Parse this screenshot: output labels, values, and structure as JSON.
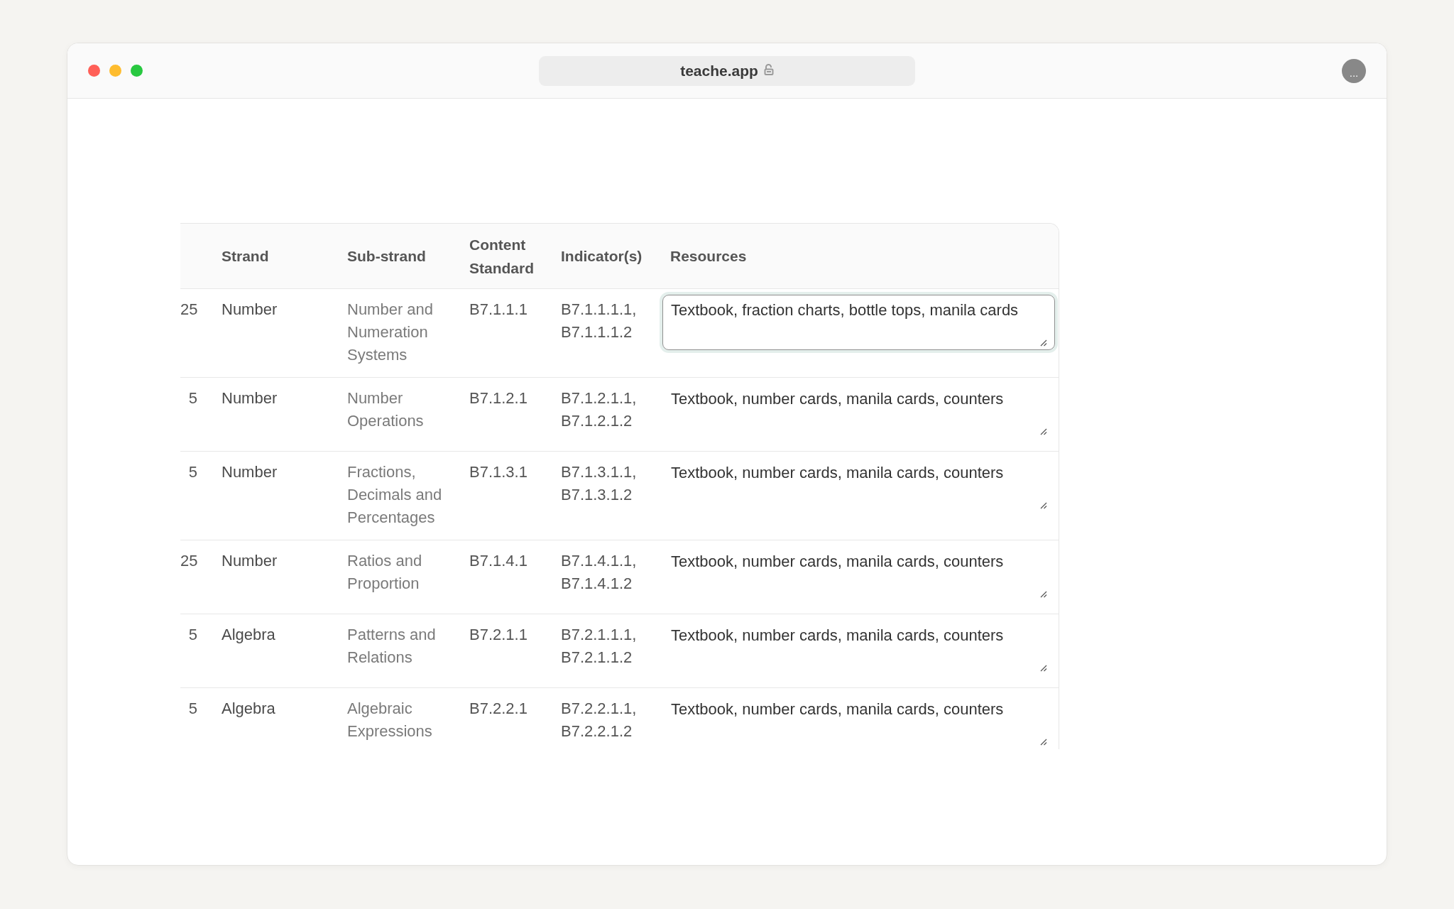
{
  "address_bar": {
    "url": "teache.app"
  },
  "menu_button": {
    "label": "..."
  },
  "table": {
    "columns": [
      "Strand",
      "Sub-strand",
      "Content Standard",
      "Indicator(s)",
      "Resources"
    ],
    "rows": [
      {
        "column_1": "25",
        "strand": "Number",
        "sub_strand": "Number and Numeration Systems",
        "content_standard": "B7.1.1.1",
        "indicators": "B7.1.1.1.1, B7.1.1.1.2",
        "resources": "Textbook, fraction charts, bottle tops, manila cards",
        "focused": true
      },
      {
        "column_1": "5",
        "strand": "Number",
        "sub_strand": "Number Operations",
        "content_standard": "B7.1.2.1",
        "indicators": "B7.1.2.1.1, B7.1.2.1.2",
        "resources": "Textbook, number cards, manila cards, counters",
        "focused": false
      },
      {
        "column_1": "5",
        "strand": "Number",
        "sub_strand": "Fractions, Decimals and Percentages",
        "content_standard": "B7.1.3.1",
        "indicators": "B7.1.3.1.1, B7.1.3.1.2",
        "resources": "Textbook, number cards, manila cards, counters",
        "focused": false
      },
      {
        "column_1": "25",
        "strand": "Number",
        "sub_strand": "Ratios and Proportion",
        "content_standard": "B7.1.4.1",
        "indicators": "B7.1.4.1.1, B7.1.4.1.2",
        "resources": "Textbook, number cards, manila cards, counters",
        "focused": false
      },
      {
        "column_1": "5",
        "strand": "Algebra",
        "sub_strand": "Patterns and Relations",
        "content_standard": "B7.2.1.1",
        "indicators": "B7.2.1.1.1, B7.2.1.1.2",
        "resources": "Textbook, number cards, manila cards, counters",
        "focused": false
      },
      {
        "column_1": "5",
        "strand": "Algebra",
        "sub_strand": "Algebraic Expressions",
        "content_standard": "B7.2.2.1",
        "indicators": "B7.2.2.1.1, B7.2.2.1.2",
        "resources": "Textbook, number cards, manila cards, counters",
        "focused": false
      }
    ]
  }
}
